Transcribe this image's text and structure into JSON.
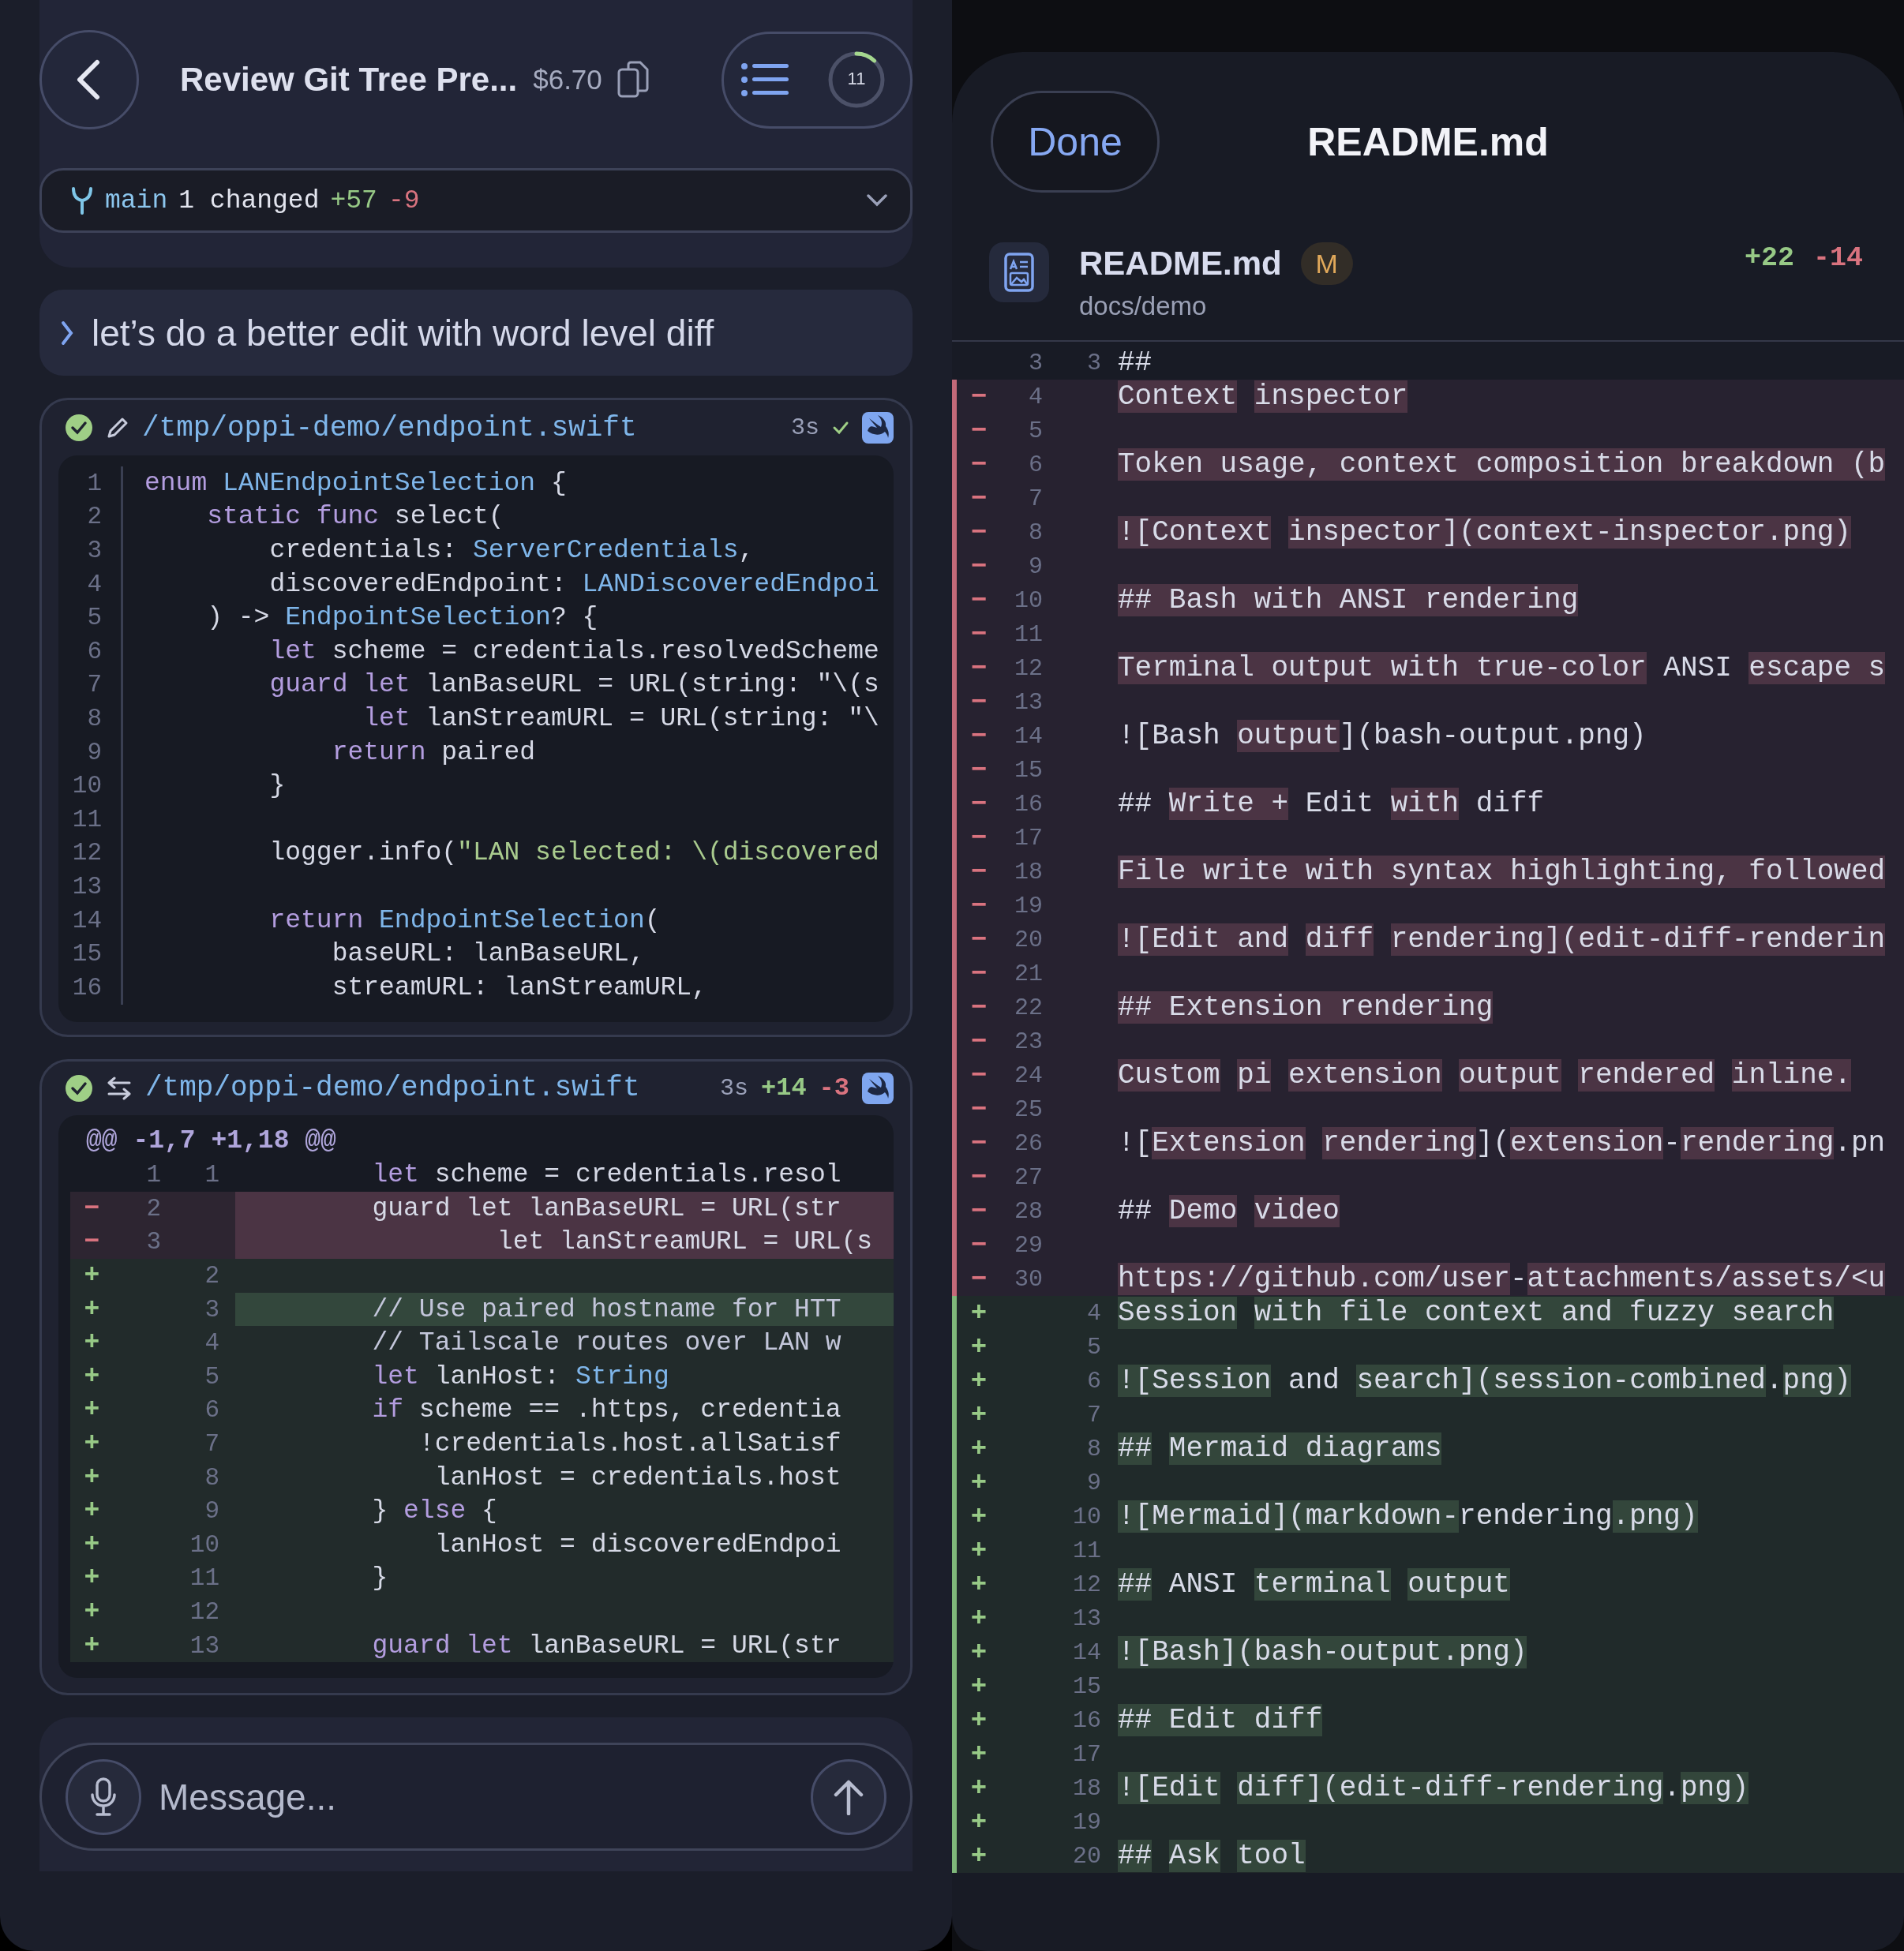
{
  "left": {
    "header": {
      "title": "Review Git Tree Pre...",
      "cost": "$6.70",
      "context": {
        "count": "11",
        "level": 0.12
      }
    },
    "branch": {
      "name": "main",
      "changed": "1 changed",
      "added": "+57",
      "removed": "-9"
    },
    "prompt": {
      "text": "let’s do a better edit with word level diff"
    },
    "tool_cards": [
      {
        "kind": "write",
        "done": true,
        "path": "/tmp/oppi-demo/endpoint.swift",
        "duration": "3s",
        "lines": [
          {
            "num": "1",
            "tokens": [
              {
                "text": "enum ",
                "kind": "keyword"
              },
              {
                "text": "LANEndpointSelection",
                "kind": "type"
              },
              {
                "text": " {",
                "kind": "plain"
              }
            ]
          },
          {
            "num": "2",
            "tokens": [
              {
                "text": "    static func",
                "kind": "keyword"
              },
              {
                "text": " select(",
                "kind": "plain"
              }
            ]
          },
          {
            "num": "3",
            "tokens": [
              {
                "text": "        credentials: ",
                "kind": "plain"
              },
              {
                "text": "ServerCredentials",
                "kind": "type"
              },
              {
                "text": ",",
                "kind": "plain"
              }
            ]
          },
          {
            "num": "4",
            "tokens": [
              {
                "text": "        discoveredEndpoint: ",
                "kind": "plain"
              },
              {
                "text": "LANDiscoveredEndpoi",
                "kind": "type"
              }
            ]
          },
          {
            "num": "5",
            "tokens": [
              {
                "text": "    ) -> ",
                "kind": "plain"
              },
              {
                "text": "EndpointSelection",
                "kind": "type"
              },
              {
                "text": "? {",
                "kind": "plain"
              }
            ]
          },
          {
            "num": "6",
            "tokens": [
              {
                "text": "        let",
                "kind": "keyword"
              },
              {
                "text": " scheme = credentials.resolvedScheme",
                "kind": "plain"
              }
            ]
          },
          {
            "num": "7",
            "tokens": [
              {
                "text": "        guard let",
                "kind": "keyword"
              },
              {
                "text": " lanBaseURL = URL(string: \"\\(s",
                "kind": "plain"
              }
            ]
          },
          {
            "num": "8",
            "tokens": [
              {
                "text": "              let",
                "kind": "keyword"
              },
              {
                "text": " lanStreamURL = URL(string: \"\\",
                "kind": "plain"
              }
            ]
          },
          {
            "num": "9",
            "tokens": [
              {
                "text": "            return",
                "kind": "keyword"
              },
              {
                "text": " paired",
                "kind": "plain"
              }
            ]
          },
          {
            "num": "10",
            "tokens": [
              {
                "text": "        }",
                "kind": "plain"
              }
            ]
          },
          {
            "num": "11"
          },
          {
            "num": "12",
            "tokens": [
              {
                "text": "        logger.info(",
                "kind": "plain"
              },
              {
                "text": "\"LAN selected: \\(discovered",
                "kind": "string"
              }
            ]
          },
          {
            "num": "13"
          },
          {
            "num": "14",
            "tokens": [
              {
                "text": "        return ",
                "kind": "keyword"
              },
              {
                "text": "EndpointSelection",
                "kind": "type"
              },
              {
                "text": "(",
                "kind": "plain"
              }
            ]
          },
          {
            "num": "15",
            "tokens": [
              {
                "text": "            baseURL: lanBaseURL,",
                "kind": "plain"
              }
            ]
          },
          {
            "num": "16",
            "tokens": [
              {
                "text": "            streamURL: lanStreamURL,",
                "kind": "plain"
              }
            ]
          }
        ]
      },
      {
        "kind": "edit",
        "done": true,
        "path": "/tmp/oppi-demo/endpoint.swift",
        "duration": "3s",
        "added": "+14",
        "removed": "-3",
        "hunk": "@@ **-1,7 +1,18** @@",
        "rows": [
          {
            "kind": "context",
            "old": "1",
            "new": "1",
            "tokens": [
              {
                "text": "        let",
                "kind": "keyword"
              },
              {
                "text": " scheme = credentials.resol",
                "kind": "plain"
              }
            ]
          },
          {
            "kind": "removed",
            "sign": "−",
            "old": "2",
            "highlight": true,
            "tokens": [
              {
                "text": "        guard let lanBaseURL = URL(str",
                "kind": "plain"
              }
            ]
          },
          {
            "kind": "removed",
            "sign": "−",
            "old": "3",
            "highlight": true,
            "tokens": [
              {
                "text": "                let lanStreamURL = URL(s",
                "kind": "plain"
              }
            ]
          },
          {
            "kind": "added",
            "sign": "+",
            "new": "2",
            "highlight": false
          },
          {
            "kind": "added",
            "sign": "+",
            "new": "3",
            "highlight": true,
            "tokens": [
              {
                "text": "        // Use paired hostname for HTT",
                "kind": "comment"
              }
            ]
          },
          {
            "kind": "added",
            "sign": "+",
            "new": "4",
            "highlight": false,
            "tokens": [
              {
                "text": "        // Tailscale routes over LAN w",
                "kind": "comment"
              }
            ]
          },
          {
            "kind": "added",
            "sign": "+",
            "new": "5",
            "highlight": false,
            "tokens": [
              {
                "text": "        let",
                "kind": "keyword"
              },
              {
                "text": " lanHost: ",
                "kind": "plain"
              },
              {
                "text": "String",
                "kind": "type"
              }
            ]
          },
          {
            "kind": "added",
            "sign": "+",
            "new": "6",
            "highlight": false,
            "tokens": [
              {
                "text": "        if",
                "kind": "keyword"
              },
              {
                "text": " scheme == .https, credentia",
                "kind": "plain"
              }
            ]
          },
          {
            "kind": "added",
            "sign": "+",
            "new": "7",
            "highlight": false,
            "tokens": [
              {
                "text": "           !credentials.host.allSatisf",
                "kind": "plain"
              }
            ]
          },
          {
            "kind": "added",
            "sign": "+",
            "new": "8",
            "highlight": false,
            "tokens": [
              {
                "text": "            lanHost = credentials.host",
                "kind": "plain"
              }
            ]
          },
          {
            "kind": "added",
            "sign": "+",
            "new": "9",
            "highlight": false,
            "tokens": [
              {
                "text": "        } ",
                "kind": "plain"
              },
              {
                "text": "else",
                "kind": "keyword"
              },
              {
                "text": " {",
                "kind": "plain"
              }
            ]
          },
          {
            "kind": "added",
            "sign": "+",
            "new": "10",
            "highlight": false,
            "tokens": [
              {
                "text": "            lanHost = discoveredEndpoi",
                "kind": "plain"
              }
            ]
          },
          {
            "kind": "added",
            "sign": "+",
            "new": "11",
            "highlight": false,
            "tokens": [
              {
                "text": "        }",
                "kind": "plain"
              }
            ]
          },
          {
            "kind": "added",
            "sign": "+",
            "new": "12",
            "highlight": false
          },
          {
            "kind": "added",
            "sign": "+",
            "new": "13",
            "highlight": false,
            "tokens": [
              {
                "text": "        guard let",
                "kind": "keyword"
              },
              {
                "text": " lanBaseURL = URL(str",
                "kind": "plain"
              }
            ]
          }
        ]
      }
    ],
    "composer": {
      "placeholder": "Message..."
    }
  },
  "right": {
    "done_label": "Done",
    "title": "README.md",
    "file": {
      "name": "README.md",
      "status": "M",
      "dir": "docs/demo",
      "added": "+22",
      "removed": "-14"
    },
    "rows": [
      {
        "kind": "context",
        "old": "3",
        "new": "3",
        "text": "##"
      },
      {
        "kind": "removed",
        "sign": "−",
        "old": "4",
        "segs": [
          {
            "text": "Context",
            "hl": true
          },
          {
            "text": "inspector",
            "hl": true,
            "gap": true
          }
        ]
      },
      {
        "kind": "removed",
        "sign": "−",
        "old": "5"
      },
      {
        "kind": "removed",
        "sign": "−",
        "old": "6",
        "segs": [
          {
            "text": "Token usage, context composition breakdown (b",
            "hl": true
          }
        ]
      },
      {
        "kind": "removed",
        "sign": "−",
        "old": "7"
      },
      {
        "kind": "removed",
        "sign": "−",
        "old": "8",
        "segs": [
          {
            "text": "![Context",
            "hl": true
          },
          {
            "text": "inspector](context-inspector.png)",
            "hl": true,
            "gap": true
          }
        ]
      },
      {
        "kind": "removed",
        "sign": "−",
        "old": "9"
      },
      {
        "kind": "removed",
        "sign": "−",
        "old": "10",
        "segs": [
          {
            "text": "## Bash with ANSI rendering",
            "hl": true
          }
        ]
      },
      {
        "kind": "removed",
        "sign": "−",
        "old": "11"
      },
      {
        "kind": "removed",
        "sign": "−",
        "old": "12",
        "segs": [
          {
            "text": "Terminal output with true-color",
            "hl": true
          },
          {
            "text": "ANSI",
            "hl": false,
            "gap": true
          },
          {
            "text": "escape s",
            "hl": true,
            "gap": true
          }
        ]
      },
      {
        "kind": "removed",
        "sign": "−",
        "old": "13"
      },
      {
        "kind": "removed",
        "sign": "−",
        "old": "14",
        "segs": [
          {
            "text": "![Bash",
            "hl": false
          },
          {
            "text": "output",
            "hl": true,
            "gap": true
          },
          {
            "text": "](bash-output.png)",
            "hl": false
          }
        ]
      },
      {
        "kind": "removed",
        "sign": "−",
        "old": "15"
      },
      {
        "kind": "removed",
        "sign": "−",
        "old": "16",
        "segs": [
          {
            "text": "##",
            "hl": false
          },
          {
            "text": "Write +",
            "hl": true,
            "gap": true
          },
          {
            "text": "Edit",
            "hl": false,
            "gap": true
          },
          {
            "text": "with",
            "hl": true,
            "gap": true
          },
          {
            "text": "diff",
            "hl": false,
            "gap": true
          }
        ]
      },
      {
        "kind": "removed",
        "sign": "−",
        "old": "17"
      },
      {
        "kind": "removed",
        "sign": "−",
        "old": "18",
        "segs": [
          {
            "text": "File write with syntax highlighting, followed",
            "hl": true
          }
        ]
      },
      {
        "kind": "removed",
        "sign": "−",
        "old": "19"
      },
      {
        "kind": "removed",
        "sign": "−",
        "old": "20",
        "segs": [
          {
            "text": "![Edit and",
            "hl": true
          },
          {
            "text": "diff",
            "hl": true,
            "gap": true
          },
          {
            "text": "rendering](edit-diff-renderin",
            "hl": true,
            "gap": true
          }
        ]
      },
      {
        "kind": "removed",
        "sign": "−",
        "old": "21"
      },
      {
        "kind": "removed",
        "sign": "−",
        "old": "22",
        "segs": [
          {
            "text": "## Extension rendering",
            "hl": true
          }
        ]
      },
      {
        "kind": "removed",
        "sign": "−",
        "old": "23"
      },
      {
        "kind": "removed",
        "sign": "−",
        "old": "24",
        "segs": [
          {
            "text": "Custom",
            "hl": true
          },
          {
            "text": "pi",
            "hl": true,
            "gap": true
          },
          {
            "text": "extension",
            "hl": true,
            "gap": true
          },
          {
            "text": "output",
            "hl": true,
            "gap": true
          },
          {
            "text": "rendered",
            "hl": true,
            "gap": true
          },
          {
            "text": "inline.",
            "hl": true,
            "gap": true
          }
        ]
      },
      {
        "kind": "removed",
        "sign": "−",
        "old": "25"
      },
      {
        "kind": "removed",
        "sign": "−",
        "old": "26",
        "segs": [
          {
            "text": "![",
            "hl": false
          },
          {
            "text": "Extension",
            "hl": true
          },
          {
            "text": "rendering",
            "hl": true,
            "gap": true
          },
          {
            "text": "](",
            "hl": false
          },
          {
            "text": "extension",
            "hl": true
          },
          {
            "text": "-",
            "hl": false
          },
          {
            "text": "rendering",
            "hl": true
          },
          {
            "text": ".pn",
            "hl": false
          }
        ]
      },
      {
        "kind": "removed",
        "sign": "−",
        "old": "27"
      },
      {
        "kind": "removed",
        "sign": "−",
        "old": "28",
        "segs": [
          {
            "text": "##",
            "hl": false
          },
          {
            "text": "Demo",
            "hl": true,
            "gap": true
          },
          {
            "text": "video",
            "hl": true,
            "gap": true
          }
        ]
      },
      {
        "kind": "removed",
        "sign": "−",
        "old": "29"
      },
      {
        "kind": "removed",
        "sign": "−",
        "old": "30",
        "segs": [
          {
            "text": "https://github.com/user",
            "hl": true
          },
          {
            "text": "-",
            "hl": false
          },
          {
            "text": "attachments/assets/<u",
            "hl": true
          }
        ]
      },
      {
        "kind": "added",
        "sign": "+",
        "new": "4",
        "segs": [
          {
            "text": "Session",
            "hl": true
          },
          {
            "text": "with file context and fuzzy search",
            "hl": true,
            "gap": true
          }
        ]
      },
      {
        "kind": "added",
        "sign": "+",
        "new": "5"
      },
      {
        "kind": "added",
        "sign": "+",
        "new": "6",
        "segs": [
          {
            "text": "![Session",
            "hl": true
          },
          {
            "text": "and",
            "hl": false,
            "gap": true
          },
          {
            "text": "search](session-combined",
            "hl": true,
            "gap": true
          },
          {
            "text": ".",
            "hl": false
          },
          {
            "text": "png)",
            "hl": true
          }
        ]
      },
      {
        "kind": "added",
        "sign": "+",
        "new": "7"
      },
      {
        "kind": "added",
        "sign": "+",
        "new": "8",
        "segs": [
          {
            "text": "##",
            "hl": true
          },
          {
            "text": "Mermaid diagrams",
            "hl": true,
            "gap": true
          }
        ]
      },
      {
        "kind": "added",
        "sign": "+",
        "new": "9"
      },
      {
        "kind": "added",
        "sign": "+",
        "new": "10",
        "segs": [
          {
            "text": "![Mermaid](markdown-",
            "hl": true
          },
          {
            "text": "rendering",
            "hl": false
          },
          {
            "text": ".png)",
            "hl": true
          }
        ]
      },
      {
        "kind": "added",
        "sign": "+",
        "new": "11"
      },
      {
        "kind": "added",
        "sign": "+",
        "new": "12",
        "segs": [
          {
            "text": "##",
            "hl": true
          },
          {
            "text": "ANSI",
            "hl": false,
            "gap": true
          },
          {
            "text": "terminal",
            "hl": true,
            "gap": true
          },
          {
            "text": "output",
            "hl": true,
            "gap": true
          }
        ]
      },
      {
        "kind": "added",
        "sign": "+",
        "new": "13"
      },
      {
        "kind": "added",
        "sign": "+",
        "new": "14",
        "segs": [
          {
            "text": "![Bash](bash-output.png)",
            "hl": true
          }
        ]
      },
      {
        "kind": "added",
        "sign": "+",
        "new": "15"
      },
      {
        "kind": "added",
        "sign": "+",
        "new": "16",
        "segs": [
          {
            "text": "## Edit diff",
            "hl": true
          }
        ]
      },
      {
        "kind": "added",
        "sign": "+",
        "new": "17"
      },
      {
        "kind": "added",
        "sign": "+",
        "new": "18",
        "segs": [
          {
            "text": "![Edit",
            "hl": true
          },
          {
            "text": "diff](edit-diff-rendering",
            "hl": true,
            "gap": true
          },
          {
            "text": ".",
            "hl": false
          },
          {
            "text": "png)",
            "hl": true
          }
        ]
      },
      {
        "kind": "added",
        "sign": "+",
        "new": "19"
      },
      {
        "kind": "added",
        "sign": "+",
        "new": "20",
        "segs": [
          {
            "text": "##",
            "hl": true
          },
          {
            "text": "Ask",
            "hl": true,
            "gap": true
          },
          {
            "text": "tool",
            "hl": true,
            "gap": true
          }
        ]
      }
    ]
  }
}
